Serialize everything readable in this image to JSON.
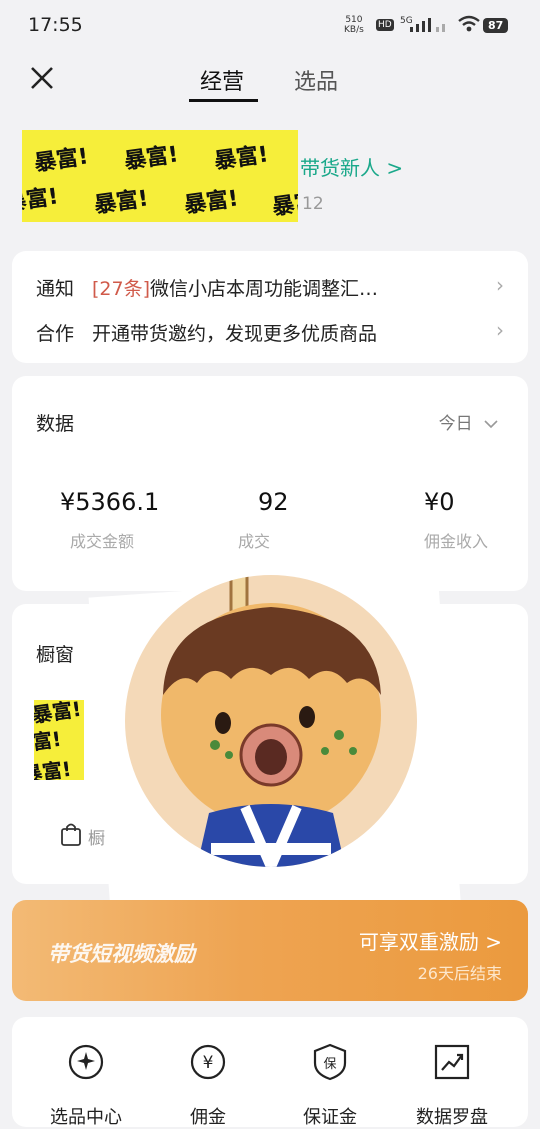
{
  "status": {
    "time": "17:55",
    "net_speed_top": "510",
    "net_speed_unit": "KB/s",
    "hd": "HD",
    "sig": "5G",
    "battery": "87"
  },
  "tabs": {
    "active": "经营",
    "other": "选品"
  },
  "profile": {
    "sticker_text": "暴富!",
    "newbie_link": "带货新人 >",
    "sub_number": "12"
  },
  "notice": {
    "row1": {
      "key": "通知",
      "tag": "[27条]",
      "text": "微信小店本周功能调整汇…"
    },
    "row2": {
      "key": "合作",
      "text": "开通带货邀约，发现更多优质商品"
    }
  },
  "data": {
    "title": "数据",
    "period": "今日",
    "metrics": [
      {
        "value": "¥5366.1",
        "label": "成交金额"
      },
      {
        "value": "92",
        "label": "成交"
      },
      {
        "value": "¥0",
        "label": "佣金收入"
      }
    ]
  },
  "shelf": {
    "title": "橱窗",
    "bag_label": "橱窗"
  },
  "banner": {
    "left": "带货短视频激励",
    "right": "可享双重激励 >",
    "sub": "26天后结束"
  },
  "tools": [
    {
      "label": "选品中心",
      "icon": "sparkle-hand-icon"
    },
    {
      "label": "佣金",
      "icon": "yen-icon"
    },
    {
      "label": "保证金",
      "icon": "shield-icon"
    },
    {
      "label": "数据罗盘",
      "icon": "chart-icon"
    }
  ],
  "colors": {
    "accent_green": "#1aa88a",
    "sticker_yellow": "#f6ee3a",
    "banner_orange": "#eea452",
    "tag_red": "#d05a4a"
  }
}
